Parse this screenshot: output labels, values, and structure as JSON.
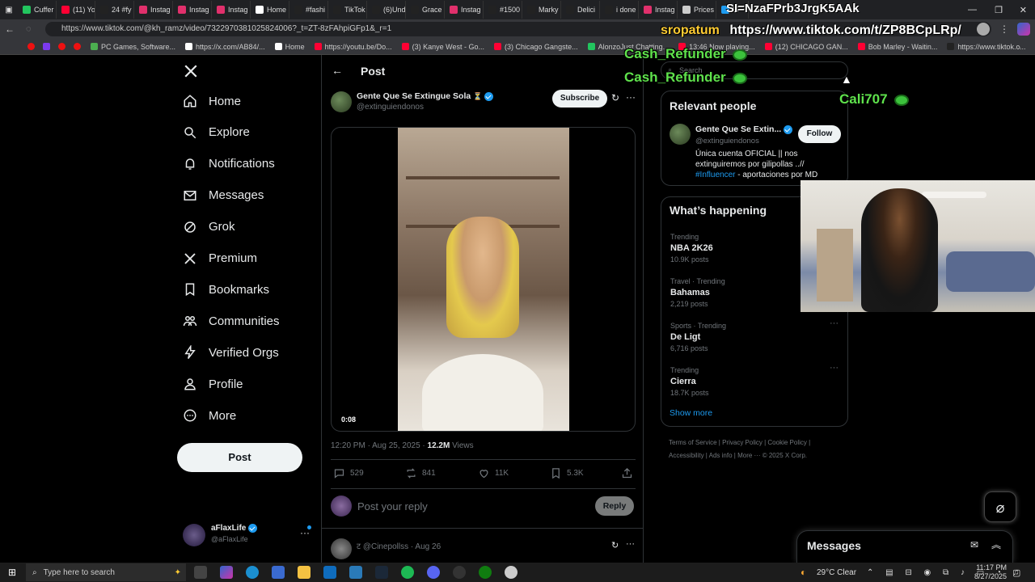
{
  "browser": {
    "tabs": [
      {
        "label": "Cuffer",
        "color": "#22c55e"
      },
      {
        "label": "(11) Yo",
        "color": "#ff0033"
      },
      {
        "label": "24 #fy",
        "color": "#222222"
      },
      {
        "label": "Instag",
        "color": "#e1306c"
      },
      {
        "label": "Instag",
        "color": "#e1306c"
      },
      {
        "label": "Instag",
        "color": "#e1306c"
      },
      {
        "label": "Home",
        "color": "#ffffff"
      },
      {
        "label": "#fashi",
        "color": "#222222"
      },
      {
        "label": "TikTok",
        "color": "#222222"
      },
      {
        "label": "(6)Und",
        "color": "#222222"
      },
      {
        "label": "Grace",
        "color": "#222222"
      },
      {
        "label": "Instag",
        "color": "#e1306c"
      },
      {
        "label": "#1500",
        "color": "#222222"
      },
      {
        "label": "Marky",
        "color": "#222222"
      },
      {
        "label": "Delici",
        "color": "#222222"
      },
      {
        "label": "i done",
        "color": "#222222"
      },
      {
        "label": "Instag",
        "color": "#e1306c"
      },
      {
        "label": "Prices",
        "color": "#cccccc"
      },
      {
        "label": "Ti",
        "color": "#1d9bf0"
      }
    ],
    "new_tab": "+",
    "url": "https://www.tiktok.com/@kh_ramz/video/7322970381025824006?_t=ZT-8zFAhpiGFp1&_r=1",
    "bookmarks": [
      {
        "label": "PC Games, Software...",
        "color": "#4caf50"
      },
      {
        "label": "https://x.com/AB84/...",
        "color": "#ffffff"
      },
      {
        "label": "Home",
        "color": "#ffffff"
      },
      {
        "label": "https://youtu.be/Do...",
        "color": "#ff0033"
      },
      {
        "label": "(3) Kanye West - Go...",
        "color": "#ff0033"
      },
      {
        "label": "(3) Chicago Gangste...",
        "color": "#ff0033"
      },
      {
        "label": "AlonzoJust Chatting...",
        "color": "#22c55e"
      },
      {
        "label": "13:46 Now playing...",
        "color": "#ff0033"
      },
      {
        "label": "(12) CHICAGO GAN...",
        "color": "#ff0033"
      },
      {
        "label": "Bob Marley - Waitin...",
        "color": "#ff0033"
      },
      {
        "label": "https://www.tiktok.c...",
        "color": "#222222"
      }
    ]
  },
  "nav": {
    "items": [
      "Home",
      "Explore",
      "Notifications",
      "Messages",
      "Grok",
      "Premium",
      "Bookmarks",
      "Communities",
      "Verified Orgs",
      "Profile",
      "More"
    ],
    "post_label": "Post",
    "account_name": "aFlaxLife",
    "account_handle": "@aFlaxLife"
  },
  "post": {
    "header_title": "Post",
    "author_name": "Gente Que Se Extingue Sola",
    "author_handle": "@extinguiendonos",
    "subscribe_label": "Subscribe",
    "video_time": "0:08",
    "timestamp": "12:20 PM · Aug 25, 2025 · ",
    "views_count": "12.2M",
    "views_label": " Views",
    "replies": "529",
    "reposts": "841",
    "likes": "11K",
    "bookmarks": "5.3K",
    "reply_placeholder": "Post your reply",
    "reply_button": "Reply",
    "next_reply_author": "ट @Cinepollss · Aug 26"
  },
  "sidebar": {
    "search_placeholder": "Search",
    "relevant_title": "Relevant people",
    "person_name": "Gente Que Se Extin...",
    "person_handle": "@extinguiendonos",
    "follow_label": "Follow",
    "person_bio_1": "Única cuenta OFICIAL || nos",
    "person_bio_2": "extinguiremos por gilipollas ..//",
    "person_bio_hashtag": "#Influencer",
    "person_bio_3": " - aportaciones por MD",
    "happening_title": "What’s happening",
    "trends": [
      {
        "context": "Trending",
        "name": "NBA 2K26",
        "posts": "10.9K posts"
      },
      {
        "context": "Travel · Trending",
        "name": "Bahamas",
        "posts": "2,219 posts"
      },
      {
        "context": "Sports · Trending",
        "name": "De Ligt",
        "posts": "6,716 posts"
      },
      {
        "context": "Trending",
        "name": "Cierra",
        "posts": "18.7K posts"
      }
    ],
    "show_more": "Show more",
    "footer_1": "Terms of Service   |   Privacy Policy   |   Cookie Policy   |",
    "footer_2": "Accessibility   |   Ads info   |   More ···   © 2025 X Corp.",
    "messages_label": "Messages"
  },
  "overlay": {
    "top_code": "SI=NzaFPrb3JrgK5AAk",
    "name_tag": "sropatum",
    "tiktok_url": "https://www.tiktok.com/t/ZP8BCpLRp/",
    "chat_1": "Cash_Refunder",
    "chat_2": "Cash_Refunder",
    "chat_3": "Cali707"
  },
  "taskbar": {
    "search_placeholder": "Type here to search",
    "weather": "29°C  Clear",
    "time": "11:17 PM",
    "date": "8/27/2025"
  }
}
